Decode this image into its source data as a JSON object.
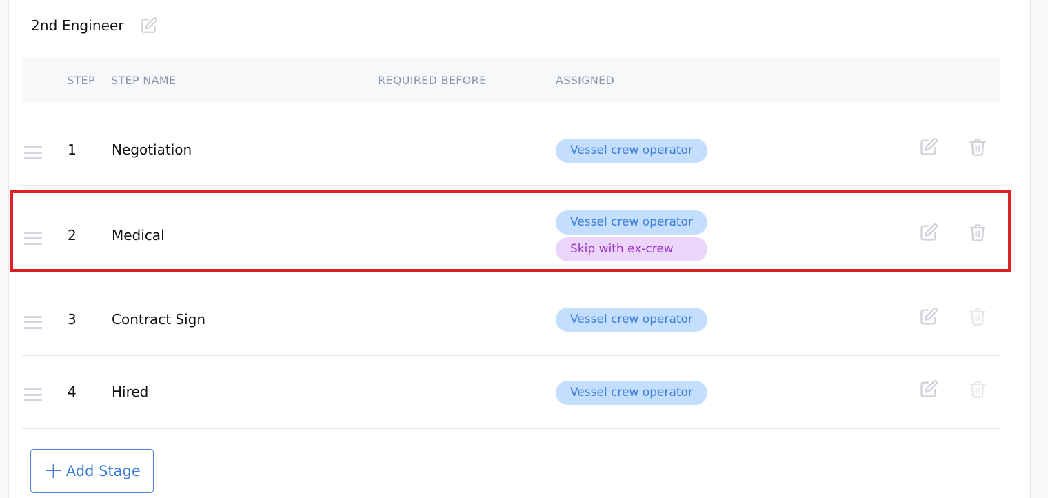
{
  "section": {
    "title": "2nd Engineer"
  },
  "table": {
    "headers": {
      "step": "STEP",
      "step_name": "STEP NAME",
      "required_before": "REQUIRED BEFORE",
      "assigned": "ASSIGNED"
    },
    "rows": [
      {
        "step": "1",
        "name": "Negotiation",
        "required_before": "",
        "tags": [
          {
            "label": "Vessel crew operator",
            "variant": "blue"
          }
        ],
        "delete_enabled": true,
        "highlighted": false
      },
      {
        "step": "2",
        "name": "Medical",
        "required_before": "",
        "tags": [
          {
            "label": "Vessel crew operator",
            "variant": "blue"
          },
          {
            "label": "Skip with ex-crew",
            "variant": "purple"
          }
        ],
        "delete_enabled": true,
        "highlighted": true
      },
      {
        "step": "3",
        "name": "Contract Sign",
        "required_before": "",
        "tags": [
          {
            "label": "Vessel crew operator",
            "variant": "blue"
          }
        ],
        "delete_enabled": false,
        "highlighted": false
      },
      {
        "step": "4",
        "name": "Hired",
        "required_before": "",
        "tags": [
          {
            "label": "Vessel crew operator",
            "variant": "blue"
          }
        ],
        "delete_enabled": false,
        "highlighted": false
      }
    ]
  },
  "actions": {
    "add_stage_label": "Add Stage",
    "add_stage_icon": "plus-icon"
  },
  "colors": {
    "tag_blue_bg": "#c4defd",
    "tag_blue_text": "#3d7ed8",
    "tag_purple_bg": "#ecd5fb",
    "tag_purple_text": "#9a34c9",
    "highlight_border": "#e02024",
    "accent": "#3d7ed8"
  }
}
